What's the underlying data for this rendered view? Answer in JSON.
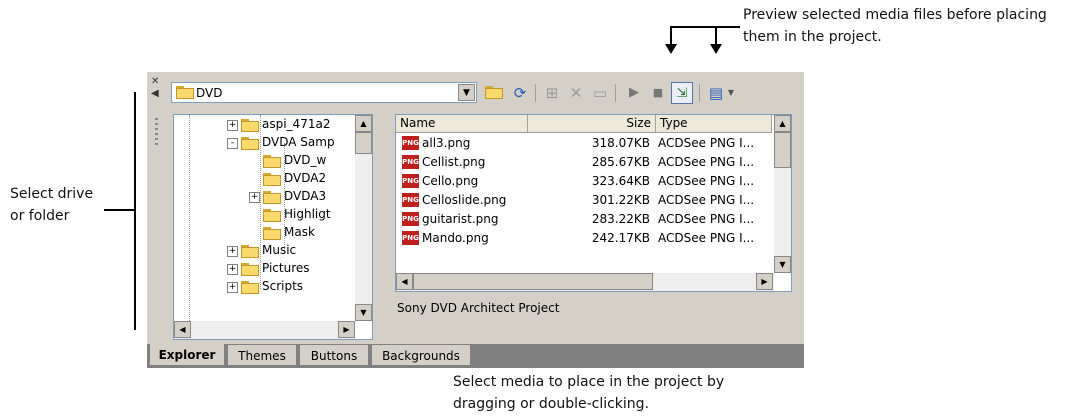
{
  "annotations": {
    "top": "Preview selected media files before placing\nthem in the project.",
    "top_line1": "Preview selected media files before placing",
    "top_line2": "them in the project.",
    "left_line1": "Select drive",
    "left_line2": "or folder",
    "bottom_line1": "Select media to place in the project by",
    "bottom_line2": "dragging or double-clicking."
  },
  "toolbar": {
    "path_value": "DVD",
    "icons": [
      "up-folder-icon",
      "refresh-icon",
      "add-icon",
      "delete-icon",
      "new-folder-icon",
      "play-icon",
      "stop-icon",
      "auto-preview-icon",
      "views-icon"
    ]
  },
  "tree": {
    "items": [
      {
        "label": "aspi_471a2",
        "expander": "+"
      },
      {
        "label": "DVDA Samp",
        "expander": "-"
      },
      {
        "label": "DVD_w",
        "expander": ""
      },
      {
        "label": "DVDA2",
        "expander": ""
      },
      {
        "label": "DVDA3",
        "expander": "+"
      },
      {
        "label": "Highligt",
        "expander": ""
      },
      {
        "label": "Mask",
        "expander": ""
      },
      {
        "label": "Music",
        "expander": "+"
      },
      {
        "label": "Pictures",
        "expander": "+"
      },
      {
        "label": "Scripts",
        "expander": "+"
      }
    ]
  },
  "list": {
    "columns": [
      "Name",
      "Size",
      "Type"
    ],
    "rows": [
      {
        "name": "all3.png",
        "size": "318.07KB",
        "type": "ACDSee PNG I..."
      },
      {
        "name": "Cellist.png",
        "size": "285.67KB",
        "type": "ACDSee PNG I..."
      },
      {
        "name": "Cello.png",
        "size": "323.64KB",
        "type": "ACDSee PNG I..."
      },
      {
        "name": "Celloslide.png",
        "size": "301.22KB",
        "type": "ACDSee PNG I..."
      },
      {
        "name": "guitarist.png",
        "size": "283.22KB",
        "type": "ACDSee PNG I..."
      },
      {
        "name": "Mando.png",
        "size": "242.17KB",
        "type": "ACDSee PNG I..."
      }
    ],
    "icon_label": "PNG"
  },
  "status": "Sony DVD Architect Project",
  "tabs": [
    "Explorer",
    "Themes",
    "Buttons",
    "Backgrounds"
  ],
  "colors": {
    "png_icon": "#c0201c",
    "folder": "#f7d96c",
    "window": "#d4d0c8"
  }
}
